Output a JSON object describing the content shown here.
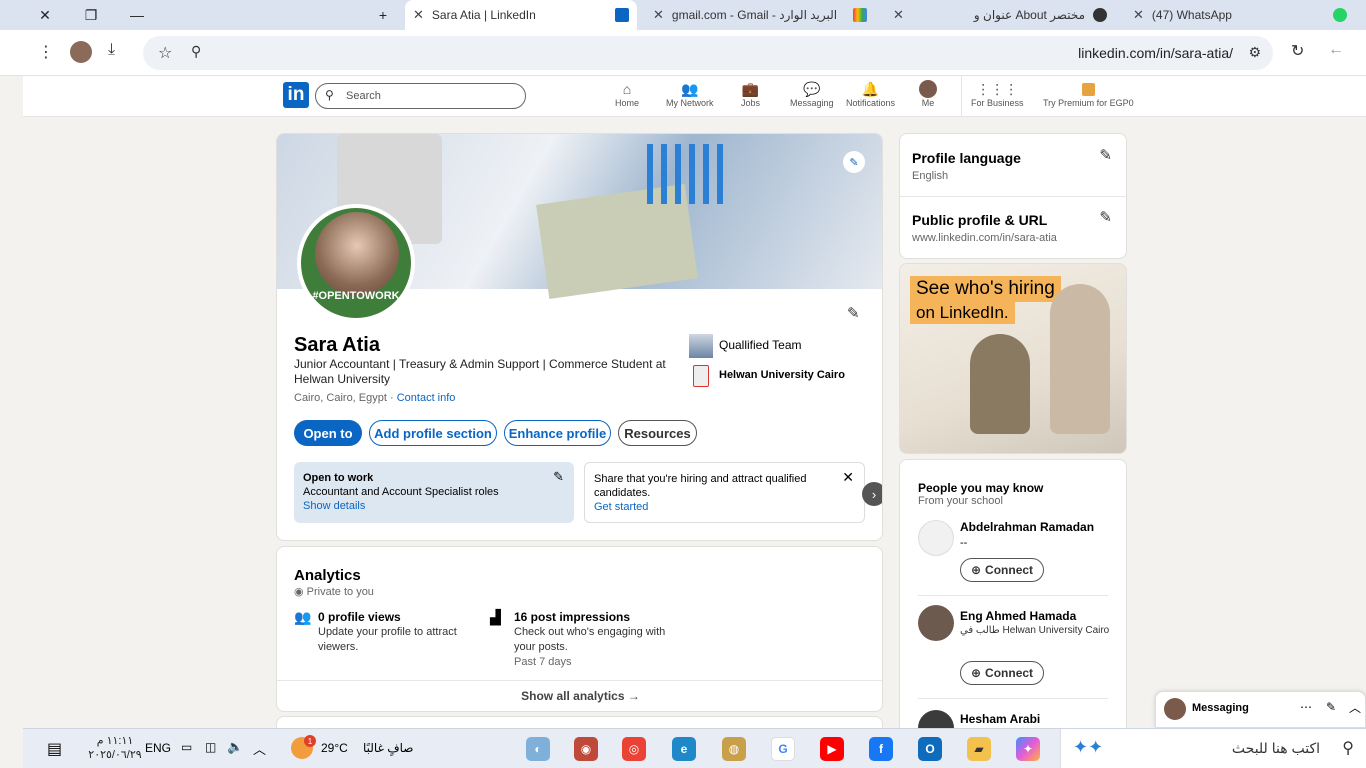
{
  "browser": {
    "tabs": [
      {
        "title": "Sara Atia | LinkedIn"
      },
      {
        "title": "gmail.com - Gmail - البريد الوارد"
      },
      {
        "title": "عنوان و About مختصر"
      },
      {
        "title": "(47) WhatsApp"
      }
    ],
    "url": "linkedin.com/in/sara-atia/"
  },
  "header": {
    "logo": "in",
    "search_placeholder": "Search",
    "nav": [
      {
        "label": "Home",
        "icon": "home-icon"
      },
      {
        "label": "My Network",
        "icon": "network-icon"
      },
      {
        "label": "Jobs",
        "icon": "jobs-icon"
      },
      {
        "label": "Messaging",
        "icon": "messaging-icon"
      },
      {
        "label": "Notifications",
        "icon": "bell-icon"
      },
      {
        "label": "Me",
        "icon": "avatar"
      },
      {
        "label": "For Business",
        "icon": "grid-icon"
      },
      {
        "label": "Try Premium for EGP0",
        "icon": "premium-icon"
      }
    ]
  },
  "profile": {
    "name": "Sara Atia",
    "headline": "Junior Accountant | Treasury & Admin Support | Commerce Student at Helwan University",
    "location": "Cairo, Cairo, Egypt ·",
    "contact_info": "Contact info",
    "open_to_work_badge": "#OPENTOWORK",
    "company": "Quallified Team",
    "school": "Helwan University Cairo",
    "buttons": {
      "open_to": "Open to",
      "add_section": "Add profile section",
      "enhance": "Enhance profile",
      "resources": "Resources"
    },
    "open_card": {
      "title": "Open to work",
      "roles": "Accountant and Account Specialist roles",
      "link": "Show details"
    },
    "hiring_card": {
      "text": "Share that you're hiring and attract qualified candidates.",
      "link": "Get started"
    }
  },
  "analytics": {
    "title": "Analytics",
    "private": "Private to you",
    "views_title": "0 profile views",
    "views_desc": "Update your profile to attract viewers.",
    "impr_title": "16 post impressions",
    "impr_desc": "Check out who's engaging with your posts.",
    "impr_period": "Past 7 days",
    "show_all": "Show all analytics →"
  },
  "sidebar": {
    "lang_title": "Profile language",
    "lang_value": "English",
    "url_title": "Public profile & URL",
    "url_value": "www.linkedin.com/in/sara-atia",
    "ad_line1": "See who's hiring",
    "ad_line2": "on LinkedIn.",
    "pymk_title": "People you may know",
    "pymk_sub": "From your school",
    "people": [
      {
        "name": "Abdelrahman Ramadan",
        "detail": "--",
        "connect": "Connect"
      },
      {
        "name": "Eng Ahmed Hamada",
        "detail": "طالب في Helwan University Cairo",
        "connect": "Connect"
      },
      {
        "name": "Hesham Arabi"
      }
    ]
  },
  "messaging": {
    "label": "Messaging"
  },
  "taskbar": {
    "time": "١١:١١ م",
    "date": "٢٠٢٥/٠٦/٢٩",
    "lang": "ENG",
    "weather": "صافٍ غالبًا",
    "temp": "29°C",
    "search": "اكتب هنا للبحث",
    "badge": "1"
  }
}
